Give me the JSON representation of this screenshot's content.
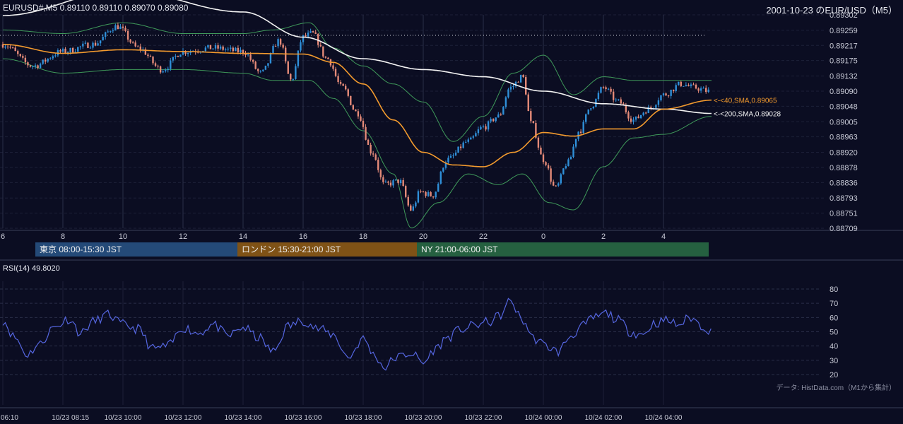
{
  "header": {
    "symbol_info": "EURUSD#,M5 0.89110 0.89110 0.89070 0.89080",
    "title": "2001-10-23 のEUR/USD（M5）"
  },
  "rsi_pane": {
    "label": "RSI(14) 49.8020",
    "source_note": "データ: HistData.com（M1から集計）"
  },
  "sessions": [
    {
      "label": "東京 08:00-15:30 JST",
      "color": "#244a78"
    },
    {
      "label": "ロンドン 15:30-21:00 JST",
      "color": "#7f5216"
    },
    {
      "label": "NY 21:00-06:00 JST",
      "color": "#256040"
    }
  ],
  "colors": {
    "background": "#0b0d22",
    "bull_candle": "#2f8fd8",
    "bear_candle": "#e48a78",
    "sma40": "#f29a2e",
    "sma200": "#f2f2f2",
    "bollinger": "#3f9a5a",
    "rsi_line": "#5566e0"
  },
  "chart_data": [
    {
      "type": "candlestick",
      "timeframe": "M5",
      "ylim": [
        0.88709,
        0.89302
      ],
      "y_ticks": [
        "0.89302",
        "0.89259",
        "0.89217",
        "0.89175",
        "0.89132",
        "0.89090",
        "0.89048",
        "0.89005",
        "0.88963",
        "0.88920",
        "0.88878",
        "0.88836",
        "0.88793",
        "0.88751",
        "0.88709"
      ],
      "x_ticks": [
        "6",
        "8",
        "10",
        "12",
        "14",
        "16",
        "18",
        "20",
        "22",
        "0",
        "2",
        "4"
      ],
      "x_tick_hours": [
        6,
        8,
        10,
        12,
        14,
        16,
        18,
        20,
        22,
        24,
        26,
        28
      ],
      "x_range_hours": [
        6,
        29.6
      ],
      "reference_level": 0.89245,
      "annotations": [
        {
          "label": "<-<40,SMA,0.89065",
          "value": 0.89065,
          "series": "sma40"
        },
        {
          "label": "<-<200,SMA,0.89028",
          "value": 0.89028,
          "series": "sma200"
        }
      ],
      "key_points": [
        {
          "t": 6.0,
          "v": 0.8922
        },
        {
          "t": 7.0,
          "v": 0.8916
        },
        {
          "t": 8.0,
          "v": 0.892
        },
        {
          "t": 9.0,
          "v": 0.8922
        },
        {
          "t": 9.8,
          "v": 0.8927
        },
        {
          "t": 10.5,
          "v": 0.8921
        },
        {
          "t": 11.3,
          "v": 0.8915
        },
        {
          "t": 12.0,
          "v": 0.892
        },
        {
          "t": 13.0,
          "v": 0.8921
        },
        {
          "t": 14.0,
          "v": 0.892
        },
        {
          "t": 14.6,
          "v": 0.8914
        },
        {
          "t": 15.2,
          "v": 0.8923
        },
        {
          "t": 15.6,
          "v": 0.8912
        },
        {
          "t": 16.0,
          "v": 0.8924
        },
        {
          "t": 16.3,
          "v": 0.8925
        },
        {
          "t": 16.8,
          "v": 0.8918
        },
        {
          "t": 17.3,
          "v": 0.891
        },
        {
          "t": 17.8,
          "v": 0.8903
        },
        {
          "t": 18.3,
          "v": 0.8892
        },
        {
          "t": 18.7,
          "v": 0.8883
        },
        {
          "t": 19.2,
          "v": 0.8884
        },
        {
          "t": 19.6,
          "v": 0.8876
        },
        {
          "t": 19.9,
          "v": 0.8881
        },
        {
          "t": 20.3,
          "v": 0.888
        },
        {
          "t": 20.8,
          "v": 0.889
        },
        {
          "t": 21.5,
          "v": 0.8895
        },
        {
          "t": 22.0,
          "v": 0.8899
        },
        {
          "t": 22.5,
          "v": 0.8902
        },
        {
          "t": 22.9,
          "v": 0.891
        },
        {
          "t": 23.3,
          "v": 0.8913
        },
        {
          "t": 23.6,
          "v": 0.89
        },
        {
          "t": 24.0,
          "v": 0.889
        },
        {
          "t": 24.4,
          "v": 0.8882
        },
        {
          "t": 24.8,
          "v": 0.8889
        },
        {
          "t": 25.2,
          "v": 0.8898
        },
        {
          "t": 25.6,
          "v": 0.8905
        },
        {
          "t": 26.0,
          "v": 0.891
        },
        {
          "t": 26.5,
          "v": 0.8906
        },
        {
          "t": 27.0,
          "v": 0.8901
        },
        {
          "t": 27.5,
          "v": 0.8904
        },
        {
          "t": 28.0,
          "v": 0.8908
        },
        {
          "t": 28.6,
          "v": 0.8911
        },
        {
          "t": 29.0,
          "v": 0.891
        },
        {
          "t": 29.5,
          "v": 0.8909
        }
      ],
      "sma40_points": [
        {
          "t": 6.0,
          "v": 0.8922
        },
        {
          "t": 8.0,
          "v": 0.89195
        },
        {
          "t": 10.0,
          "v": 0.89205
        },
        {
          "t": 12.0,
          "v": 0.892
        },
        {
          "t": 14.0,
          "v": 0.89195
        },
        {
          "t": 16.0,
          "v": 0.89193
        },
        {
          "t": 17.0,
          "v": 0.8917
        },
        {
          "t": 18.0,
          "v": 0.8911
        },
        {
          "t": 19.0,
          "v": 0.8901
        },
        {
          "t": 20.0,
          "v": 0.8892
        },
        {
          "t": 21.0,
          "v": 0.88885
        },
        {
          "t": 22.0,
          "v": 0.8888
        },
        {
          "t": 23.0,
          "v": 0.8892
        },
        {
          "t": 24.0,
          "v": 0.88975
        },
        {
          "t": 25.0,
          "v": 0.88965
        },
        {
          "t": 26.0,
          "v": 0.88985
        },
        {
          "t": 27.0,
          "v": 0.88985
        },
        {
          "t": 28.0,
          "v": 0.8904
        },
        {
          "t": 29.6,
          "v": 0.89065
        }
      ],
      "sma200_points": [
        {
          "t": 6.0,
          "v": 0.893
        },
        {
          "t": 10.0,
          "v": 0.8937
        },
        {
          "t": 14.0,
          "v": 0.8931
        },
        {
          "t": 16.0,
          "v": 0.8924
        },
        {
          "t": 18.0,
          "v": 0.8918
        },
        {
          "t": 20.0,
          "v": 0.8915
        },
        {
          "t": 22.0,
          "v": 0.8913
        },
        {
          "t": 24.0,
          "v": 0.8909
        },
        {
          "t": 26.0,
          "v": 0.89055
        },
        {
          "t": 28.0,
          "v": 0.8904
        },
        {
          "t": 29.6,
          "v": 0.89028
        }
      ],
      "bb_upper_points": [
        {
          "t": 6.0,
          "v": 0.8926
        },
        {
          "t": 8.0,
          "v": 0.8925
        },
        {
          "t": 10.0,
          "v": 0.8928
        },
        {
          "t": 12.0,
          "v": 0.8925
        },
        {
          "t": 14.0,
          "v": 0.8925
        },
        {
          "t": 15.0,
          "v": 0.8926
        },
        {
          "t": 16.2,
          "v": 0.8928
        },
        {
          "t": 17.0,
          "v": 0.8921
        },
        {
          "t": 18.0,
          "v": 0.8916
        },
        {
          "t": 19.0,
          "v": 0.8911
        },
        {
          "t": 20.0,
          "v": 0.8906
        },
        {
          "t": 21.0,
          "v": 0.8895
        },
        {
          "t": 22.0,
          "v": 0.8902
        },
        {
          "t": 23.0,
          "v": 0.8914
        },
        {
          "t": 24.0,
          "v": 0.8919
        },
        {
          "t": 25.0,
          "v": 0.8908
        },
        {
          "t": 26.0,
          "v": 0.8913
        },
        {
          "t": 27.0,
          "v": 0.8912
        },
        {
          "t": 28.0,
          "v": 0.8912
        },
        {
          "t": 29.6,
          "v": 0.8912
        }
      ],
      "bb_lower_points": [
        {
          "t": 6.0,
          "v": 0.8918
        },
        {
          "t": 8.0,
          "v": 0.8914
        },
        {
          "t": 10.0,
          "v": 0.8915
        },
        {
          "t": 12.0,
          "v": 0.8915
        },
        {
          "t": 14.0,
          "v": 0.8914
        },
        {
          "t": 15.0,
          "v": 0.8912
        },
        {
          "t": 16.2,
          "v": 0.8912
        },
        {
          "t": 17.0,
          "v": 0.8907
        },
        {
          "t": 18.0,
          "v": 0.8898
        },
        {
          "t": 19.0,
          "v": 0.8886
        },
        {
          "t": 19.6,
          "v": 0.8871
        },
        {
          "t": 20.5,
          "v": 0.8878
        },
        {
          "t": 21.5,
          "v": 0.8886
        },
        {
          "t": 22.5,
          "v": 0.8883
        },
        {
          "t": 23.3,
          "v": 0.8886
        },
        {
          "t": 24.2,
          "v": 0.8878
        },
        {
          "t": 25.0,
          "v": 0.8876
        },
        {
          "t": 26.0,
          "v": 0.8888
        },
        {
          "t": 27.0,
          "v": 0.8896
        },
        {
          "t": 28.0,
          "v": 0.8897
        },
        {
          "t": 29.6,
          "v": 0.8902
        }
      ]
    },
    {
      "type": "line",
      "title": "RSI(14) 49.8020",
      "ylim": [
        20,
        80
      ],
      "y_ticks": [
        20,
        30,
        40,
        50,
        60,
        70,
        80
      ],
      "x_ticks": [
        "06:10",
        "10/23 08:15",
        "10/23 10:00",
        "10/23 12:00",
        "10/23 14:00",
        "10/23 16:00",
        "10/23 18:00",
        "10/23 20:00",
        "10/23 22:00",
        "10/24 00:00",
        "10/24 02:00",
        "10/24 04:00"
      ],
      "x_tick_hours": [
        6.1,
        8.25,
        10,
        12,
        14,
        16,
        18,
        20,
        22,
        24,
        26,
        28
      ],
      "series": [
        {
          "points": [
            {
              "t": 6.0,
              "v": 58
            },
            {
              "t": 6.4,
              "v": 46
            },
            {
              "t": 6.8,
              "v": 34
            },
            {
              "t": 7.2,
              "v": 41
            },
            {
              "t": 7.7,
              "v": 53
            },
            {
              "t": 8.2,
              "v": 59
            },
            {
              "t": 8.6,
              "v": 49
            },
            {
              "t": 9.0,
              "v": 57
            },
            {
              "t": 9.5,
              "v": 62
            },
            {
              "t": 10.0,
              "v": 55
            },
            {
              "t": 10.5,
              "v": 52
            },
            {
              "t": 11.0,
              "v": 38
            },
            {
              "t": 11.5,
              "v": 40
            },
            {
              "t": 12.0,
              "v": 53
            },
            {
              "t": 12.5,
              "v": 49
            },
            {
              "t": 13.0,
              "v": 55
            },
            {
              "t": 13.5,
              "v": 47
            },
            {
              "t": 14.0,
              "v": 53
            },
            {
              "t": 14.5,
              "v": 46
            },
            {
              "t": 15.0,
              "v": 36
            },
            {
              "t": 15.5,
              "v": 54
            },
            {
              "t": 16.0,
              "v": 58
            },
            {
              "t": 16.5,
              "v": 52
            },
            {
              "t": 17.0,
              "v": 48
            },
            {
              "t": 17.5,
              "v": 32
            },
            {
              "t": 18.0,
              "v": 45
            },
            {
              "t": 18.4,
              "v": 33
            },
            {
              "t": 18.7,
              "v": 25
            },
            {
              "t": 19.1,
              "v": 32
            },
            {
              "t": 19.6,
              "v": 35
            },
            {
              "t": 20.0,
              "v": 28
            },
            {
              "t": 20.4,
              "v": 38
            },
            {
              "t": 20.8,
              "v": 46
            },
            {
              "t": 21.3,
              "v": 52
            },
            {
              "t": 21.8,
              "v": 55
            },
            {
              "t": 22.2,
              "v": 57
            },
            {
              "t": 22.6,
              "v": 62
            },
            {
              "t": 22.9,
              "v": 72
            },
            {
              "t": 23.3,
              "v": 58
            },
            {
              "t": 23.7,
              "v": 45
            },
            {
              "t": 24.1,
              "v": 40
            },
            {
              "t": 24.5,
              "v": 36
            },
            {
              "t": 24.9,
              "v": 47
            },
            {
              "t": 25.3,
              "v": 54
            },
            {
              "t": 25.7,
              "v": 60
            },
            {
              "t": 26.1,
              "v": 63
            },
            {
              "t": 26.5,
              "v": 58
            },
            {
              "t": 26.9,
              "v": 50
            },
            {
              "t": 27.3,
              "v": 48
            },
            {
              "t": 27.7,
              "v": 56
            },
            {
              "t": 28.1,
              "v": 58
            },
            {
              "t": 28.5,
              "v": 55
            },
            {
              "t": 28.9,
              "v": 60
            },
            {
              "t": 29.3,
              "v": 54
            },
            {
              "t": 29.6,
              "v": 50
            }
          ]
        }
      ]
    }
  ]
}
